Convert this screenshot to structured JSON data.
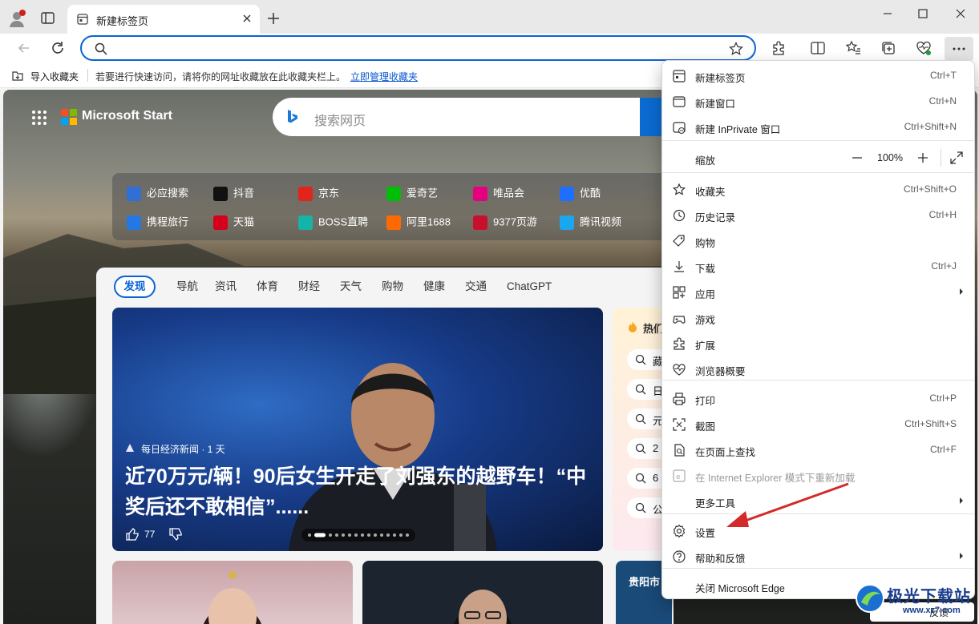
{
  "tab": {
    "title": "新建标签页"
  },
  "address_bar": {
    "value": "",
    "placeholder": ""
  },
  "favorites_bar": {
    "import_label": "导入收藏夹",
    "hint": "若要进行快速访问，请将你的网址收藏放在此收藏夹栏上。",
    "manage_link": "立即管理收藏夹"
  },
  "newtab": {
    "brand": "Microsoft Start",
    "search_placeholder": "搜索网页",
    "quick_links": [
      {
        "label": "必应搜索",
        "icon": "search-icon",
        "color": "#2f6fd6"
      },
      {
        "label": "抖音",
        "icon": "douyin-icon",
        "color": "#111111"
      },
      {
        "label": "京东",
        "icon": "jd-icon",
        "color": "#e1251b"
      },
      {
        "label": "爱奇艺",
        "icon": "iqiyi-icon",
        "color": "#00be06"
      },
      {
        "label": "唯品会",
        "icon": "vip-icon",
        "color": "#e4007f"
      },
      {
        "label": "优酷",
        "icon": "youku-icon",
        "color": "#1e6fff"
      },
      {
        "label": "携程旅行",
        "icon": "ctrip-icon",
        "color": "#2577e3"
      },
      {
        "label": "天猫",
        "icon": "tmall-icon",
        "color": "#d6001c"
      },
      {
        "label": "BOSS直聘",
        "icon": "boss-icon",
        "color": "#16b3a8"
      },
      {
        "label": "阿里1688",
        "icon": "ali1688-icon",
        "color": "#ff6a00"
      },
      {
        "label": "9377页游",
        "icon": "game9377-icon",
        "color": "#c8102e"
      },
      {
        "label": "腾讯视频",
        "icon": "tencent-video-icon",
        "color": "#1aa7f0"
      }
    ],
    "feed_tabs": [
      "发现",
      "导航",
      "资讯",
      "体育",
      "财经",
      "天气",
      "购物",
      "健康",
      "交通",
      "ChatGPT"
    ],
    "hero": {
      "source": "每日经济新闻 · 1 天",
      "headline": "近70万元/辆！90后女生开走了刘强东的越野车！“中奖后还不敢相信”......",
      "likes": "77"
    },
    "hot": {
      "label": "热们",
      "items": [
        "藏",
        "日",
        "元",
        "2",
        "6",
        "公"
      ]
    },
    "weather_city": "贵阳市",
    "feedback": "反馈"
  },
  "menu": {
    "items": [
      {
        "label": "新建标签页",
        "shortcut": "Ctrl+T",
        "icon": "new-tab-icon"
      },
      {
        "label": "新建窗口",
        "shortcut": "Ctrl+N",
        "icon": "new-window-icon"
      },
      {
        "label": "新建 InPrivate 窗口",
        "shortcut": "Ctrl+Shift+N",
        "icon": "inprivate-icon"
      },
      {
        "label": "收藏夹",
        "shortcut": "Ctrl+Shift+O",
        "icon": "favorites-icon"
      },
      {
        "label": "历史记录",
        "shortcut": "Ctrl+H",
        "icon": "history-icon"
      },
      {
        "label": "购物",
        "shortcut": "",
        "icon": "shopping-tag-icon"
      },
      {
        "label": "下载",
        "shortcut": "Ctrl+J",
        "icon": "download-icon"
      },
      {
        "label": "应用",
        "shortcut": "",
        "icon": "apps-icon"
      },
      {
        "label": "游戏",
        "shortcut": "",
        "icon": "games-icon"
      },
      {
        "label": "扩展",
        "shortcut": "",
        "icon": "extensions-icon"
      },
      {
        "label": "浏览器概要",
        "shortcut": "",
        "icon": "browser-essentials-icon"
      },
      {
        "label": "打印",
        "shortcut": "Ctrl+P",
        "icon": "print-icon"
      },
      {
        "label": "截图",
        "shortcut": "Ctrl+Shift+S",
        "icon": "screenshot-icon"
      },
      {
        "label": "在页面上查找",
        "shortcut": "Ctrl+F",
        "icon": "find-icon"
      },
      {
        "label": "在 Internet Explorer 模式下重新加载",
        "shortcut": "",
        "icon": "ie-mode-icon"
      },
      {
        "label": "更多工具",
        "shortcut": "",
        "icon": "more-tools-icon"
      },
      {
        "label": "设置",
        "shortcut": "",
        "icon": "settings-icon"
      },
      {
        "label": "帮助和反馈",
        "shortcut": "",
        "icon": "help-icon"
      },
      {
        "label": "关闭 Microsoft Edge",
        "shortcut": "",
        "icon": "close-edge-icon"
      }
    ],
    "zoom": {
      "label": "缩放",
      "value": "100%"
    }
  },
  "watermark": {
    "text": "极光下载站",
    "url": "www.xz7.com"
  },
  "colors": {
    "accent": "#0b63d6",
    "annotation_arrow": "#d42a2a"
  }
}
